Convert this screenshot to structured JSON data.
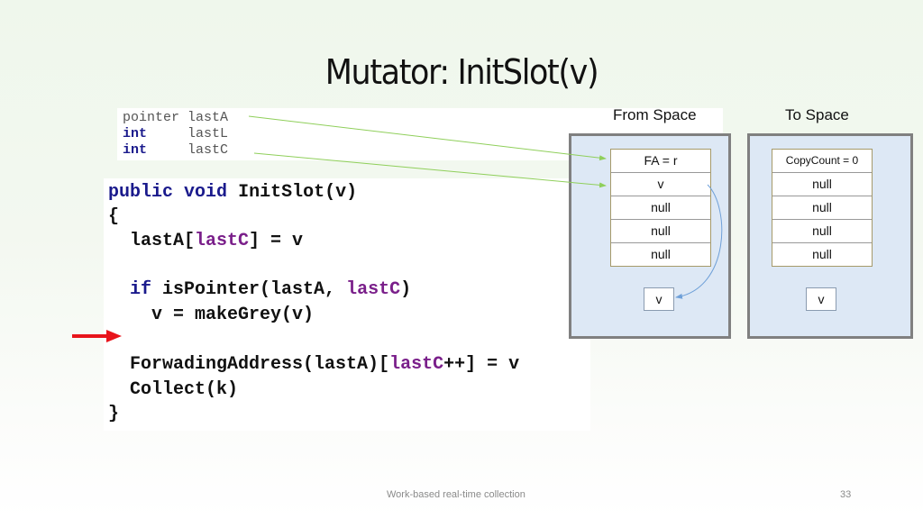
{
  "slide": {
    "title": "Mutator: InitSlot(v)",
    "footer_text": "Work-based real-time collection",
    "page_number": "33"
  },
  "variables": [
    {
      "type": "pointer",
      "name": "lastA"
    },
    {
      "type": "int",
      "name": "lastL"
    },
    {
      "type": "int",
      "name": "lastC"
    }
  ],
  "code": {
    "line1_kw1": "public",
    "line1_kw2": "void",
    "line1_rest": "InitSlot(v)",
    "line2": "{",
    "line3_a": "  lastA[",
    "line3_b": "lastC",
    "line3_c": "] = v",
    "line5_kw": "  if",
    "line5_a": " isPointer(lastA, ",
    "line5_b": "lastC",
    "line5_c": ")",
    "line6": "    v = makeGrey(v)",
    "line8_a": "  ForwadingAddress(lastA)[",
    "line8_b": "lastC",
    "line8_c": "++] = v",
    "line9": "  Collect(k)",
    "line10": "}"
  },
  "from_space": {
    "label": "From Space",
    "cells": [
      "FA = r",
      "v",
      "null",
      "null",
      "null"
    ],
    "object": "v"
  },
  "to_space": {
    "label": "To Space",
    "cells": [
      "CopyCount = 0",
      "null",
      "null",
      "null",
      "null"
    ],
    "object": "v"
  },
  "colors": {
    "keyword": "#1a1a8c",
    "variable": "#7a1f8a",
    "pointer_arrow": "#8fcf5a",
    "forward_arrow": "#6fa0d8",
    "current_line_arrow": "#e8141b"
  }
}
